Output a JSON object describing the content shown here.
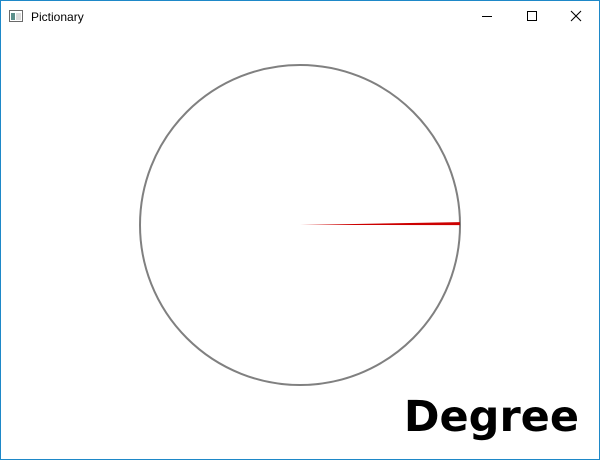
{
  "window": {
    "title": "Pictionary",
    "icon": "app-window-icon",
    "controls": [
      "minimize-icon",
      "maximize-icon",
      "close-icon"
    ]
  },
  "dial": {
    "circle_color": "#808080",
    "hand_color": "#cc0000",
    "hand_angle_deg": 0.5
  },
  "label": {
    "text": "Degree"
  }
}
